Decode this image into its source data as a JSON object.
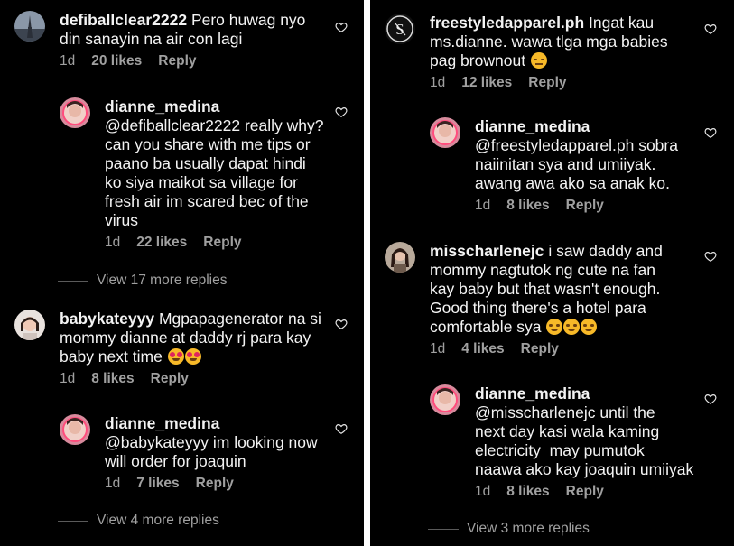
{
  "left": {
    "c1": {
      "user": "defiballclear2222",
      "lines": [
        "Pero huwag nyo",
        "din sanayin na air con lagi"
      ],
      "time": "1d",
      "likes": "20 likes",
      "reply": "Reply"
    },
    "r1": {
      "user": "dianne_medina",
      "lines": [
        "@defiballclear2222 really why?",
        "can you share with me tips or",
        "paano ba usually dapat hindi",
        "ko siya maikot sa village for",
        "fresh air im scared bec of the",
        "virus"
      ],
      "time": "1d",
      "likes": "22 likes",
      "reply": "Reply"
    },
    "view1": "View 17 more replies",
    "c2": {
      "user": "babykateyyy",
      "lines": [
        "Mgpapagenerator na si",
        "mommy dianne at daddy rj para kay",
        "baby next time "
      ],
      "time": "1d",
      "likes": "8 likes",
      "reply": "Reply"
    },
    "r2": {
      "user": "dianne_medina",
      "lines": [
        "@babykateyyy im looking now",
        "will order for joaquin"
      ],
      "time": "1d",
      "likes": "7 likes",
      "reply": "Reply"
    },
    "view2": "View 4 more replies"
  },
  "right": {
    "c1": {
      "user": "freestyledapparel.ph",
      "lines": [
        "Ingat kau",
        "ms.dianne. wawa tlga mga babies",
        "pag brownout "
      ],
      "time": "1d",
      "likes": "12 likes",
      "reply": "Reply"
    },
    "r1": {
      "user": "dianne_medina",
      "lines": [
        "@freestyledapparel.ph sobra",
        "naiinitan sya and umiiyak.",
        "awang awa ako sa anak ko."
      ],
      "time": "1d",
      "likes": "8 likes",
      "reply": "Reply"
    },
    "c2": {
      "user": "misscharlenejc",
      "lines": [
        "i saw daddy and",
        "mommy nagtutok ng cute na fan",
        "kay baby but that wasn't enough.",
        "Good thing there's a hotel para",
        "comfortable sya "
      ],
      "time": "1d",
      "likes": "4 likes",
      "reply": "Reply"
    },
    "r2": {
      "user": "dianne_medina",
      "lines": [
        "@misscharlenejc until the",
        "next day kasi wala kaming",
        "electricity  may pumutok",
        "naawa ako kay joaquin umiiyak"
      ],
      "time": "1d",
      "likes": "8 likes",
      "reply": "Reply"
    },
    "view": "View 3 more replies"
  },
  "icons": {
    "like": "heart-outline-icon",
    "emoji_joy": "smiling-emoji",
    "emoji_love": "heart-eyes-emoji",
    "emoji_sad": "pensive-emoji"
  },
  "colors": {
    "background": "#000000",
    "text": "#f3f3f3",
    "muted": "#a0a0a0",
    "divider": "#ffffff"
  }
}
